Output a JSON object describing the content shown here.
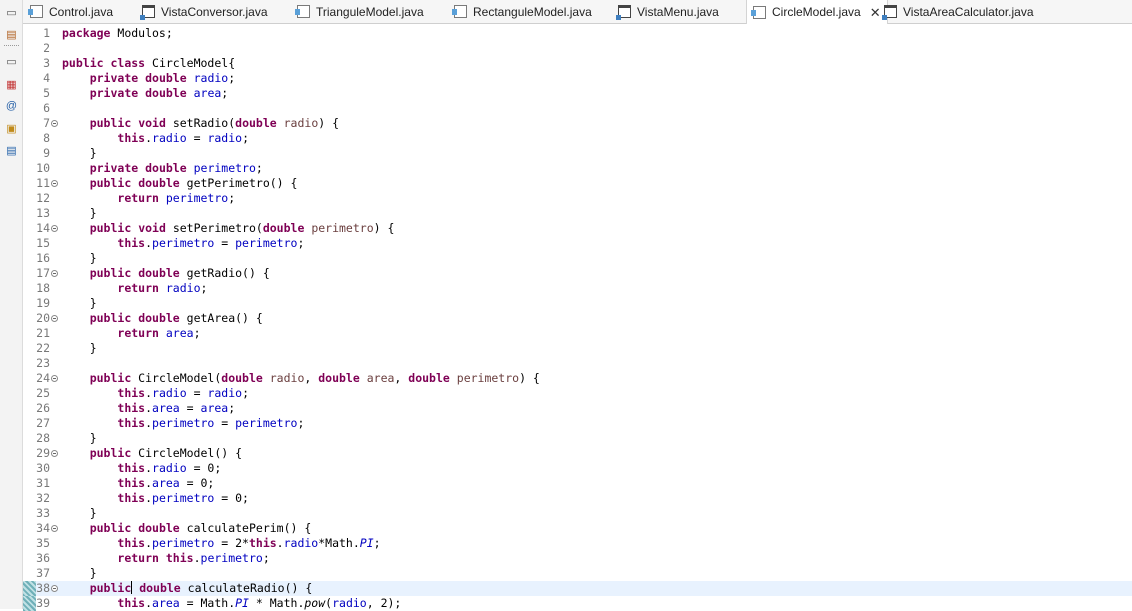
{
  "tabs": [
    {
      "label": "Control.java",
      "icon": "java-file-icon"
    },
    {
      "label": "VistaConversor.java",
      "icon": "java-frame-icon"
    },
    {
      "label": "TrianguleModel.java",
      "icon": "java-file-icon"
    },
    {
      "label": "RectanguleModel.java",
      "icon": "java-file-icon"
    },
    {
      "label": "VistaMenu.java",
      "icon": "java-frame-icon"
    },
    {
      "label": "CircleModel.java",
      "icon": "java-file-icon",
      "active": true
    },
    {
      "label": "VistaAreaCalculator.java",
      "icon": "java-frame-icon"
    }
  ],
  "active_tab_close": "✕",
  "left_toolbar": [
    "restore-icon",
    "package-explorer-icon",
    "restore-icon",
    "outline-icon",
    "javadoc-icon",
    "declaration-icon",
    "console-icon"
  ],
  "colors": {
    "keyword": "#7f0055",
    "field": "#0000c0",
    "parameter": "#6a3e3e",
    "line_number": "#787878",
    "current_line": "#e8f2fe"
  },
  "editor": {
    "current_line": 38,
    "lines": [
      {
        "n": "1",
        "text": "package Modulos;"
      },
      {
        "n": "2",
        "text": ""
      },
      {
        "n": "3",
        "text": "public class CircleModel{"
      },
      {
        "n": "4",
        "text": "    private double radio;"
      },
      {
        "n": "5",
        "text": "    private double area;"
      },
      {
        "n": "6",
        "text": ""
      },
      {
        "n": "7",
        "text": "    public void setRadio(double radio) {",
        "fold": true
      },
      {
        "n": "8",
        "text": "        this.radio = radio;"
      },
      {
        "n": "9",
        "text": "    }"
      },
      {
        "n": "10",
        "text": "    private double perimetro;"
      },
      {
        "n": "11",
        "text": "    public double getPerimetro() {",
        "fold": true
      },
      {
        "n": "12",
        "text": "        return perimetro;"
      },
      {
        "n": "13",
        "text": "    }"
      },
      {
        "n": "14",
        "text": "    public void setPerimetro(double perimetro) {",
        "fold": true
      },
      {
        "n": "15",
        "text": "        this.perimetro = perimetro;"
      },
      {
        "n": "16",
        "text": "    }"
      },
      {
        "n": "17",
        "text": "    public double getRadio() {",
        "fold": true
      },
      {
        "n": "18",
        "text": "        return radio;"
      },
      {
        "n": "19",
        "text": "    }"
      },
      {
        "n": "20",
        "text": "    public double getArea() {",
        "fold": true
      },
      {
        "n": "21",
        "text": "        return area;"
      },
      {
        "n": "22",
        "text": "    }"
      },
      {
        "n": "23",
        "text": ""
      },
      {
        "n": "24",
        "text": "    public CircleModel(double radio, double area, double perimetro) {",
        "fold": true
      },
      {
        "n": "25",
        "text": "        this.radio = radio;"
      },
      {
        "n": "26",
        "text": "        this.area = area;"
      },
      {
        "n": "27",
        "text": "        this.perimetro = perimetro;"
      },
      {
        "n": "28",
        "text": "    }"
      },
      {
        "n": "29",
        "text": "    public CircleModel() {",
        "fold": true
      },
      {
        "n": "30",
        "text": "        this.radio = 0;"
      },
      {
        "n": "31",
        "text": "        this.area = 0;"
      },
      {
        "n": "32",
        "text": "        this.perimetro = 0;"
      },
      {
        "n": "33",
        "text": "    }"
      },
      {
        "n": "34",
        "text": "    public double calculatePerim() {",
        "fold": true
      },
      {
        "n": "35",
        "text": "        this.perimetro = 2*this.radio*Math.PI;"
      },
      {
        "n": "36",
        "text": "        return this.perimetro;"
      },
      {
        "n": "37",
        "text": "    }"
      },
      {
        "n": "38",
        "text": "    public double calculateRadio() {",
        "fold": true
      },
      {
        "n": "39",
        "text": "        this.area = Math.PI * Math.pow(radio, 2);"
      }
    ]
  }
}
